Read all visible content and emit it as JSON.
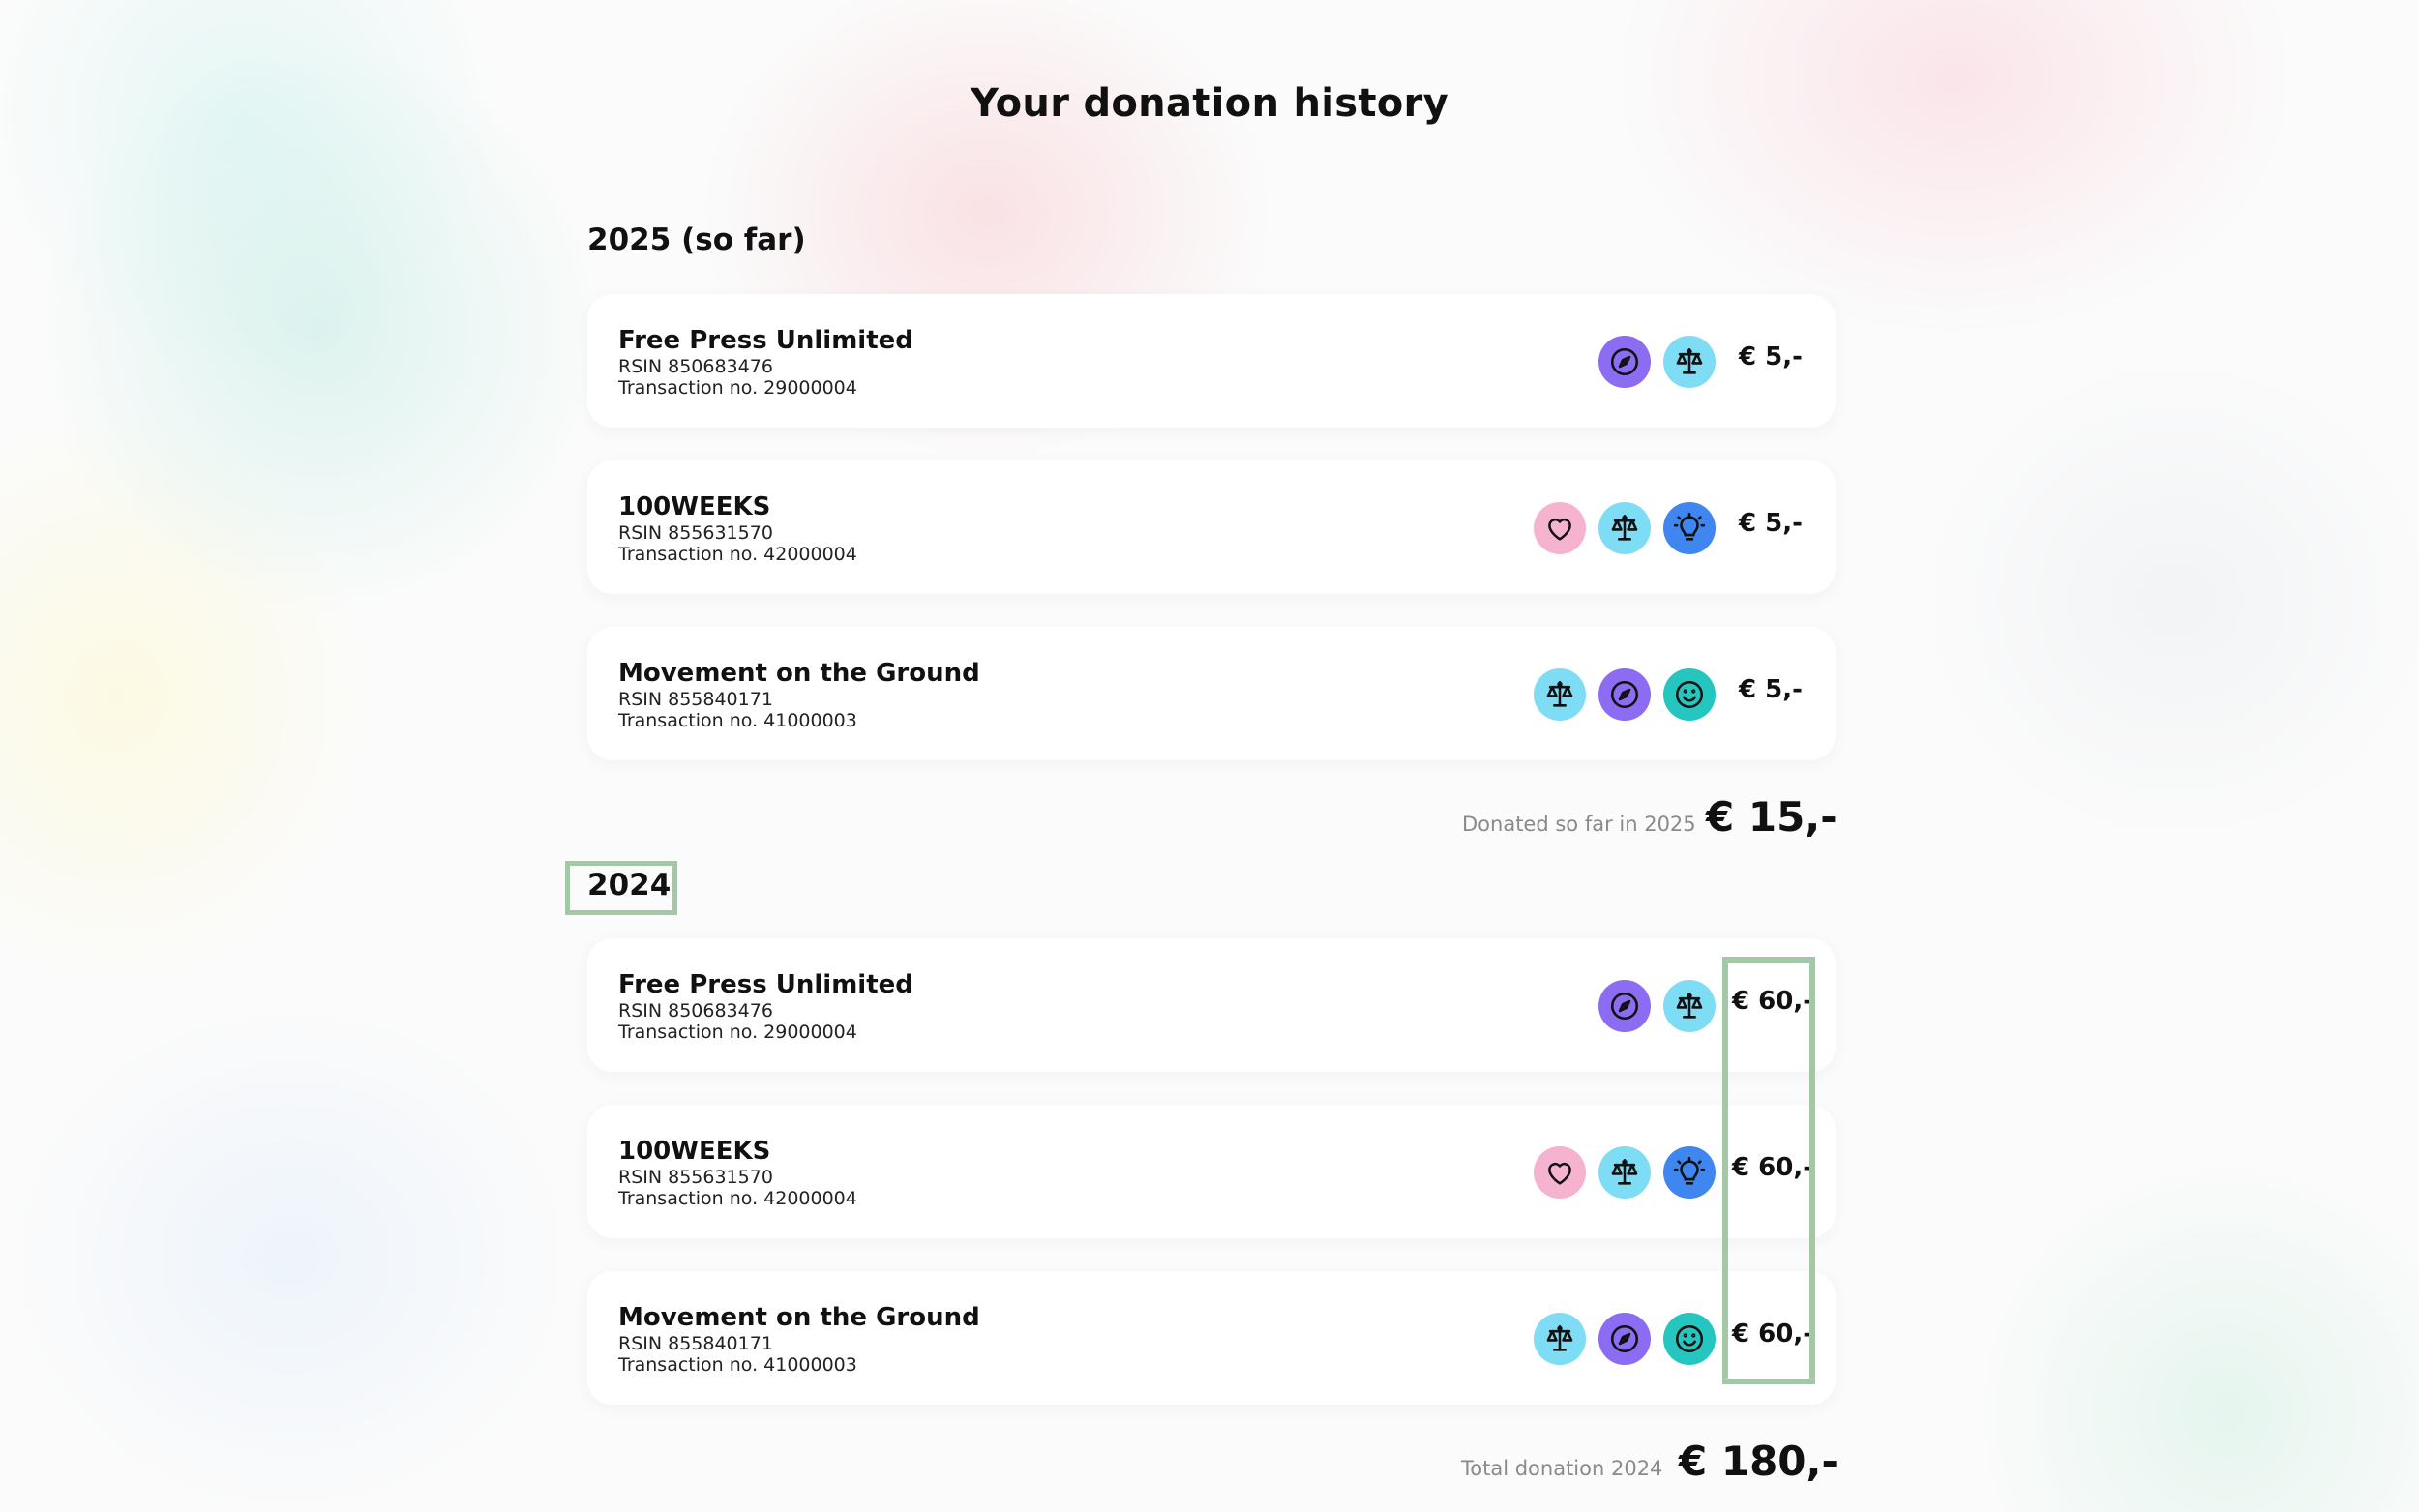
{
  "page_title": "Your donation history",
  "years": [
    {
      "heading": "2025 (so far)",
      "donations": [
        {
          "name": "Free Press Unlimited",
          "rsin": "RSIN 850683476",
          "transaction": "Transaction no. 29000004",
          "amount": "€ 5,-",
          "icons": [
            "compass-icon",
            "scales-icon"
          ]
        },
        {
          "name": "100WEEKS",
          "rsin": "RSIN 855631570",
          "transaction": "Transaction no. 42000004",
          "amount": "€ 5,-",
          "icons": [
            "heart-icon",
            "scales-icon",
            "lightbulb-icon"
          ]
        },
        {
          "name": "Movement on the Ground",
          "rsin": "RSIN 855840171",
          "transaction": "Transaction no. 41000003",
          "amount": "€ 5,-",
          "icons": [
            "scales-icon",
            "compass-icon",
            "smiley-icon"
          ]
        }
      ],
      "total_label": "Donated so far in 2025",
      "total_value": "€ 15,-"
    },
    {
      "heading": "2024",
      "donations": [
        {
          "name": "Free Press Unlimited",
          "rsin": "RSIN 850683476",
          "transaction": "Transaction no. 29000004",
          "amount": "€ 60,-",
          "icons": [
            "compass-icon",
            "scales-icon"
          ]
        },
        {
          "name": "100WEEKS",
          "rsin": "RSIN 855631570",
          "transaction": "Transaction no. 42000004",
          "amount": "€ 60,-",
          "icons": [
            "heart-icon",
            "scales-icon",
            "lightbulb-icon"
          ]
        },
        {
          "name": "Movement on the Ground",
          "rsin": "RSIN 855840171",
          "transaction": "Transaction no. 41000003",
          "amount": "€ 60,-",
          "icons": [
            "scales-icon",
            "compass-icon",
            "smiley-icon"
          ]
        }
      ],
      "total_label": "Total donation 2024",
      "total_value": "€ 180,-"
    }
  ],
  "icon_colors": {
    "compass-icon": "#8b6cf2",
    "scales-icon": "#7fdcf5",
    "heart-icon": "#f6b3cf",
    "lightbulb-icon": "#3f86f0",
    "smiley-icon": "#25c6c0"
  },
  "highlight_color": "#a3c8a8"
}
